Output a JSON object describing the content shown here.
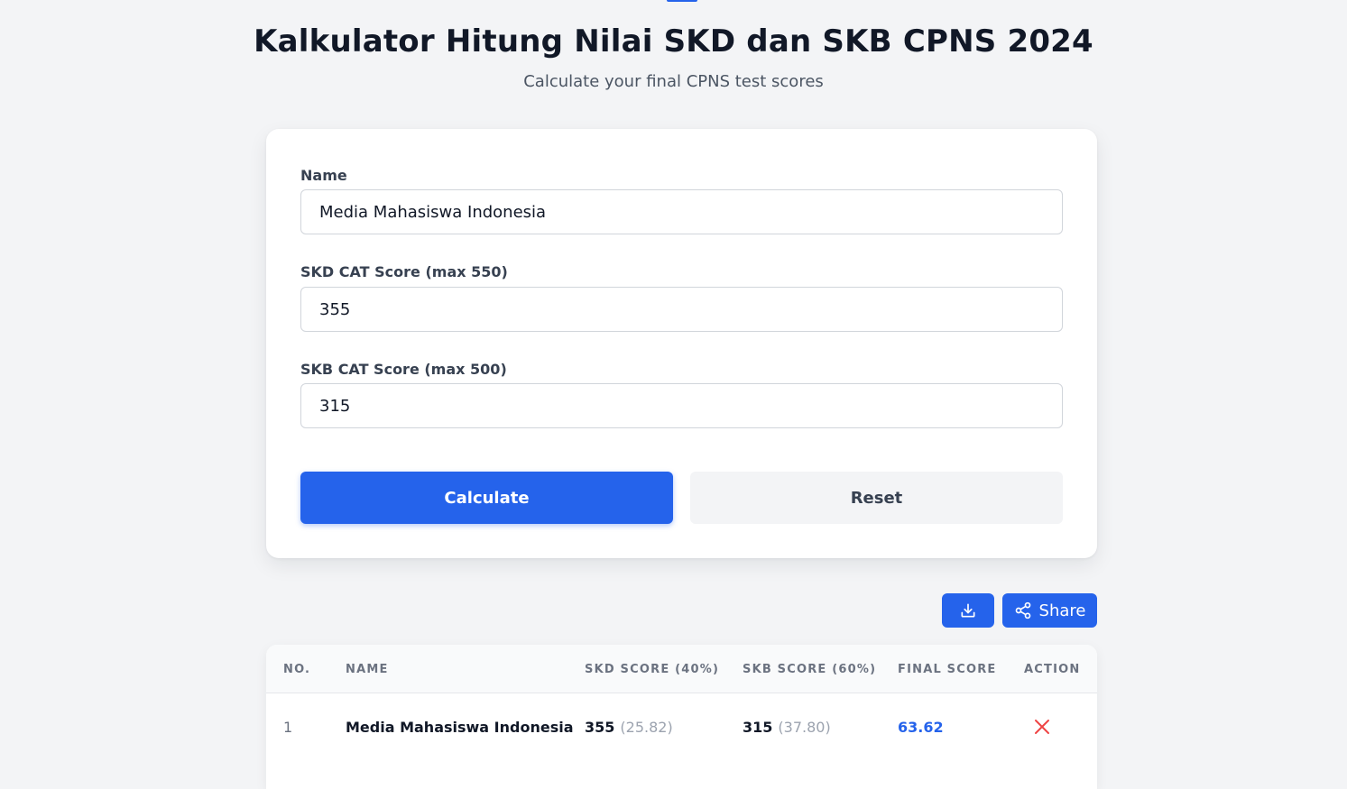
{
  "header": {
    "title": "Kalkulator Hitung Nilai SKD dan SKB CPNS 2024",
    "subtitle": "Calculate your final CPNS test scores"
  },
  "form": {
    "name": {
      "label": "Name",
      "value": "Media Mahasiswa Indonesia"
    },
    "skd": {
      "label": "SKD CAT Score (max 550)",
      "value": "355"
    },
    "skb": {
      "label": "SKB CAT Score (max 500)",
      "value": "315"
    },
    "calculate_label": "Calculate",
    "reset_label": "Reset"
  },
  "results_actions": {
    "download_icon": "download-icon",
    "share_icon": "share-icon",
    "share_label": "Share"
  },
  "table": {
    "columns": {
      "no": "No.",
      "name": "Name",
      "skd": "SKD Score (40%)",
      "skb": "SKB Score (60%)",
      "final": "Final Score",
      "action": "Action"
    },
    "rows": [
      {
        "no": "1",
        "name": "Media Mahasiswa Indonesia",
        "skd": "355",
        "skd_weighted": "(25.82)",
        "skb": "315",
        "skb_weighted": "(37.80)",
        "final": "63.62",
        "action_icon": "close-icon"
      }
    ]
  },
  "colors": {
    "accent": "#2563eb",
    "delete": "#ef4444",
    "background": "#f3f4f6"
  }
}
